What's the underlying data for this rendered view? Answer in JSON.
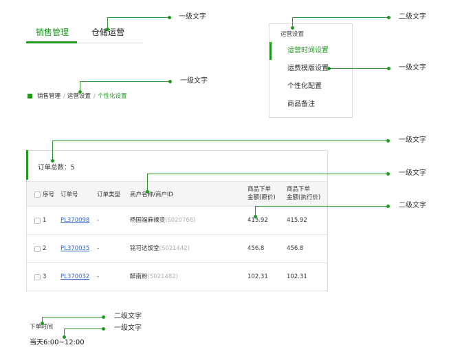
{
  "tabs": {
    "items": [
      {
        "label": "销售管理",
        "active": true
      },
      {
        "label": "仓储运营",
        "active": false
      }
    ]
  },
  "menu": {
    "header": "运营设置",
    "items": [
      {
        "label": "运营时间设置",
        "active": true
      },
      {
        "label": "运费模版设置",
        "active": false
      },
      {
        "label": "个性化配置",
        "active": false
      },
      {
        "label": "商品备注",
        "active": false
      }
    ]
  },
  "breadcrumb": {
    "items": [
      "销售管理",
      "运营设置"
    ],
    "separator": "/",
    "current": "个性化设置"
  },
  "orders": {
    "count_text": "订单总数：5",
    "headers": {
      "seq": "序号",
      "order_no": "订单号",
      "order_type": "订单类型",
      "merchant": "商户名称/商户ID",
      "amount_orig_line1": "商品下单",
      "amount_orig_line2": "金额(原价)",
      "amount_exec_line1": "商品下单",
      "amount_exec_line2": "金额(执行价)"
    },
    "rows": [
      {
        "seq": "1",
        "order_no": "PL370098",
        "type": "-",
        "merchant": "杨国福麻辣烫",
        "merchant_id": "(S020768)",
        "amount_orig": "415.92",
        "amount_exec": "415.92"
      },
      {
        "seq": "2",
        "order_no": "PL370035",
        "type": "-",
        "merchant": "铭可达饭堂",
        "merchant_id": "(S021442)",
        "amount_orig": "456.8",
        "amount_exec": "456.8"
      },
      {
        "seq": "3",
        "order_no": "PL370032",
        "type": "-",
        "merchant": "醉南粉",
        "merchant_id": "(S021482)",
        "amount_orig": "102.31",
        "amount_exec": "102.31"
      }
    ]
  },
  "order_time": {
    "label": "下单时间",
    "value": "当天6:00~12:00"
  },
  "annotations": {
    "tabs": "一级文字",
    "menu_header": "二级文字",
    "menu_item": "一级文字",
    "breadcrumb": "一级文字",
    "order_count": "一级文字",
    "table_header": "一级文字",
    "table_value": "二级文字",
    "time_label": "二级文字",
    "time_value": "一级文字"
  },
  "colors": {
    "accent": "#1f9a1f",
    "link": "#3366cc",
    "muted": "#b0b0b0"
  }
}
